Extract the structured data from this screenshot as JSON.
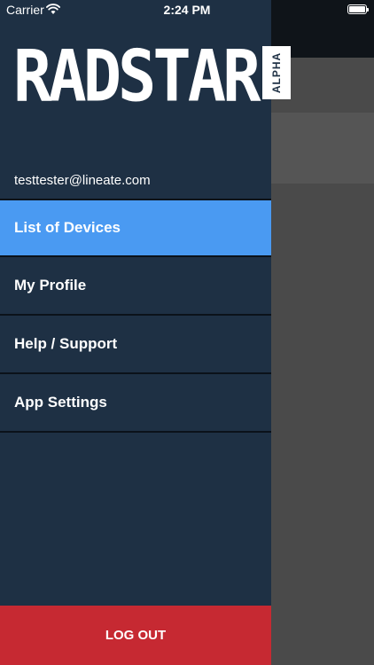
{
  "status_bar": {
    "carrier": "Carrier",
    "time": "2:24 PM"
  },
  "brand": {
    "logo_text": "RADSTAR",
    "badge_text": "ALPHA"
  },
  "user": {
    "email": "testtester@lineate.com"
  },
  "menu": [
    {
      "label": "List of Devices",
      "active": true
    },
    {
      "label": "My Profile",
      "active": false
    },
    {
      "label": "Help / Support",
      "active": false
    },
    {
      "label": "App Settings",
      "active": false
    }
  ],
  "logout": {
    "label": "LOG OUT"
  },
  "colors": {
    "drawer_bg": "#1e3044",
    "active_item": "#4a9af2",
    "logout_bg": "#c62932",
    "overlay_bg": "#4a4a4a"
  },
  "icons": {
    "wifi": "wifi-icon",
    "battery": "battery-icon"
  }
}
